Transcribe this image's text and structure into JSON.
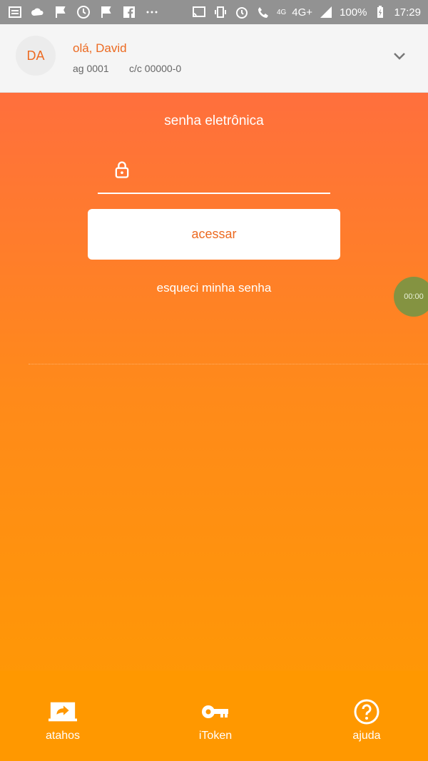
{
  "status_bar": {
    "network": "4G",
    "network_plus": "4G+",
    "battery": "100%",
    "time": "17:29"
  },
  "header": {
    "initials": "DA",
    "greeting": "olá, David",
    "agency": "ag 0001",
    "account": "c/c 00000-0"
  },
  "login": {
    "title": "senha eletrônica",
    "password_placeholder": "",
    "submit": "acessar",
    "forgot": "esqueci minha senha"
  },
  "overlay": {
    "timer": "00:00"
  },
  "bottom_nav": {
    "items": [
      {
        "label": "atahos",
        "icon": "shortcut-icon"
      },
      {
        "label": "iToken",
        "icon": "key-icon"
      },
      {
        "label": "ajuda",
        "icon": "help-icon"
      }
    ]
  },
  "colors": {
    "accent": "#ec6a21",
    "gradient_top": "#ff6f3d",
    "gradient_bottom": "#ff9b00"
  }
}
